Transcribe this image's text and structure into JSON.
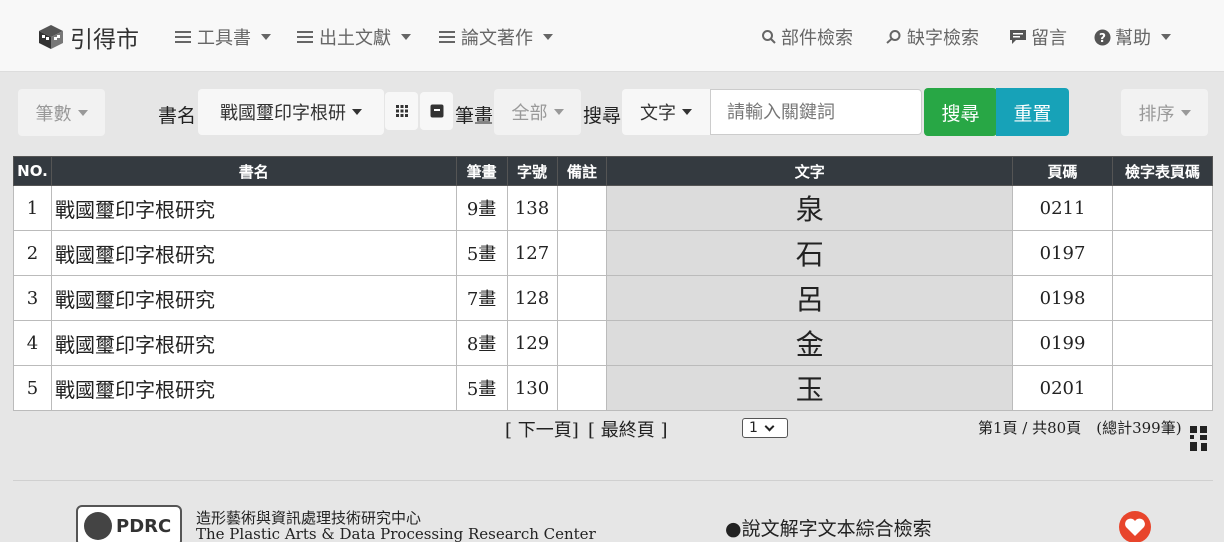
{
  "nav": {
    "brand": "引得市",
    "menus": [
      {
        "label": "工具書"
      },
      {
        "label": "出土文獻"
      },
      {
        "label": "論文著作"
      }
    ],
    "right": [
      {
        "icon": "search-icon",
        "label": "部件檢索"
      },
      {
        "icon": "search-plus-icon",
        "label": "缺字檢索"
      },
      {
        "icon": "comment-icon",
        "label": "留言"
      },
      {
        "icon": "help-icon",
        "label": "幫助"
      }
    ]
  },
  "toolbar": {
    "strokes_dropdown": "筆數",
    "book_label": "書名",
    "book_value": "戰國璽印字根研",
    "stroke_label": "筆畫",
    "stroke_value": "全部",
    "search_label": "搜尋",
    "search_type": "文字",
    "search_placeholder": "請輸入關鍵詞",
    "search_button": "搜尋",
    "reset_button": "重置",
    "sort_dropdown": "排序"
  },
  "table": {
    "headers": [
      "NO.",
      "書名",
      "筆畫",
      "字號",
      "備註",
      "文字",
      "頁碼",
      "檢字表頁碼"
    ],
    "rows": [
      {
        "no": "1",
        "book": "戰國璽印字根研究",
        "strokes": "9畫",
        "num": "138",
        "note": "",
        "char": "泉",
        "page": "0211",
        "index_page": ""
      },
      {
        "no": "2",
        "book": "戰國璽印字根研究",
        "strokes": "5畫",
        "num": "127",
        "note": "",
        "char": "石",
        "page": "0197",
        "index_page": ""
      },
      {
        "no": "3",
        "book": "戰國璽印字根研究",
        "strokes": "7畫",
        "num": "128",
        "note": "",
        "char": "呂",
        "page": "0198",
        "index_page": ""
      },
      {
        "no": "4",
        "book": "戰國璽印字根研究",
        "strokes": "8畫",
        "num": "129",
        "note": "",
        "char": "金",
        "page": "0199",
        "index_page": ""
      },
      {
        "no": "5",
        "book": "戰國璽印字根研究",
        "strokes": "5畫",
        "num": "130",
        "note": "",
        "char": "玉",
        "page": "0201",
        "index_page": ""
      }
    ]
  },
  "pager": {
    "next": "[ 下一頁]",
    "last": "[ 最終頁 ]",
    "page_select": "1",
    "summary": "第1頁 / 共80頁　(總計399筆)"
  },
  "footer": {
    "logo_text": "PDRC",
    "org_zh": "造形藝術與資訊處理技術研究中心",
    "org_en": "The Plastic Arts & Data Processing Research Center",
    "link": "●說文解字文本綜合檢索"
  },
  "colors": {
    "search_button": "#28a745",
    "reset_button": "#17a2b8",
    "table_header": "#343a40",
    "char_cell": "#dcdcdc"
  }
}
